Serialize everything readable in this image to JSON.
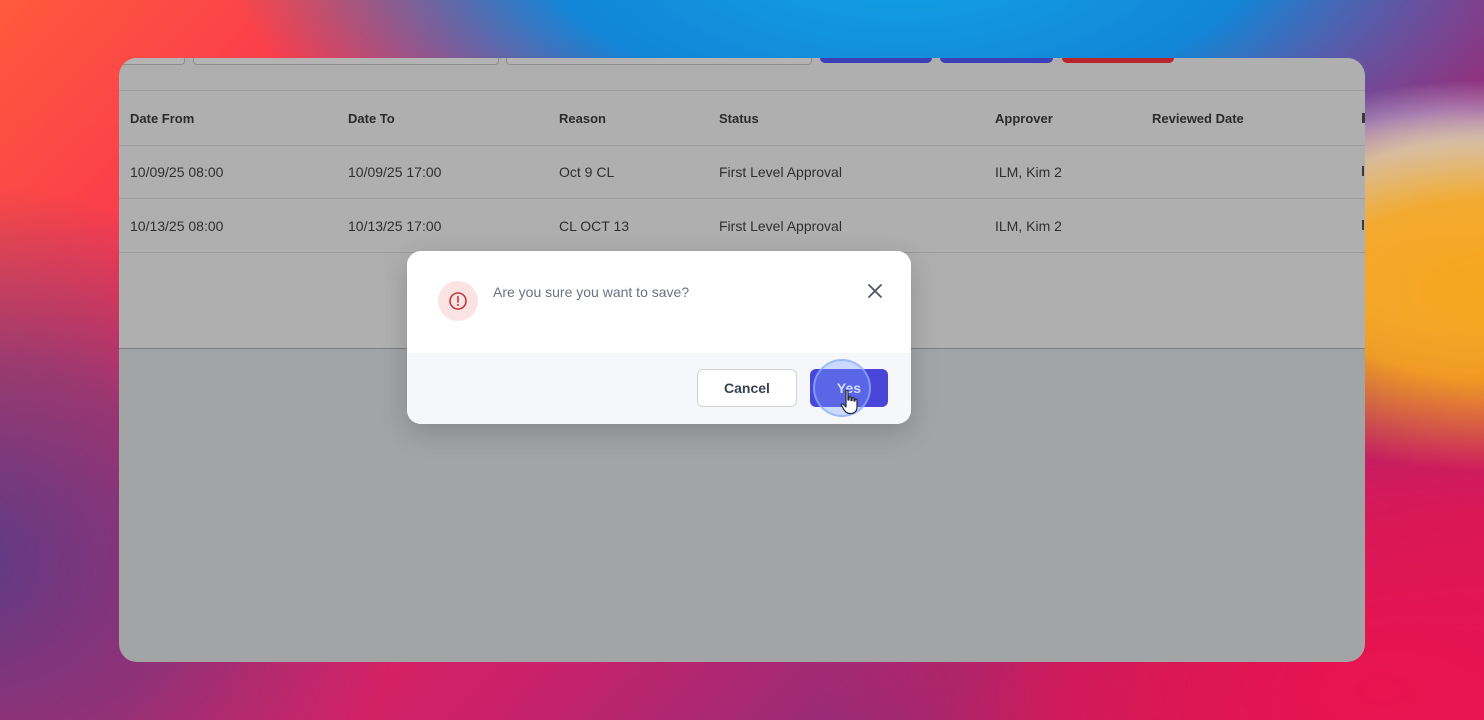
{
  "table": {
    "columns": [
      "Date From",
      "Date To",
      "Reason",
      "Status",
      "Approver",
      "Reviewed Date"
    ],
    "rows": [
      {
        "date_from": "10/09/25 08:00",
        "date_to": "10/09/25 17:00",
        "reason": "Oct 9 CL",
        "status": "First Level Approval",
        "approver": "ILM, Kim 2",
        "reviewed_date": ""
      },
      {
        "date_from": "10/13/25 08:00",
        "date_to": "10/13/25 17:00",
        "reason": "CL OCT 13",
        "status": "First Level Approval",
        "approver": "ILM, Kim 2",
        "reviewed_date": ""
      }
    ]
  },
  "toolbar": {
    "primary_color": "#3b3fb8",
    "danger_color": "#b8262c"
  },
  "dialog": {
    "message": "Are you sure you want to save?",
    "cancel_label": "Cancel",
    "confirm_label": "Yes",
    "icon": "alert-circle-icon",
    "close_icon": "close-icon",
    "confirm_color": "#4a47d8",
    "alert_color": "#c0393b"
  }
}
